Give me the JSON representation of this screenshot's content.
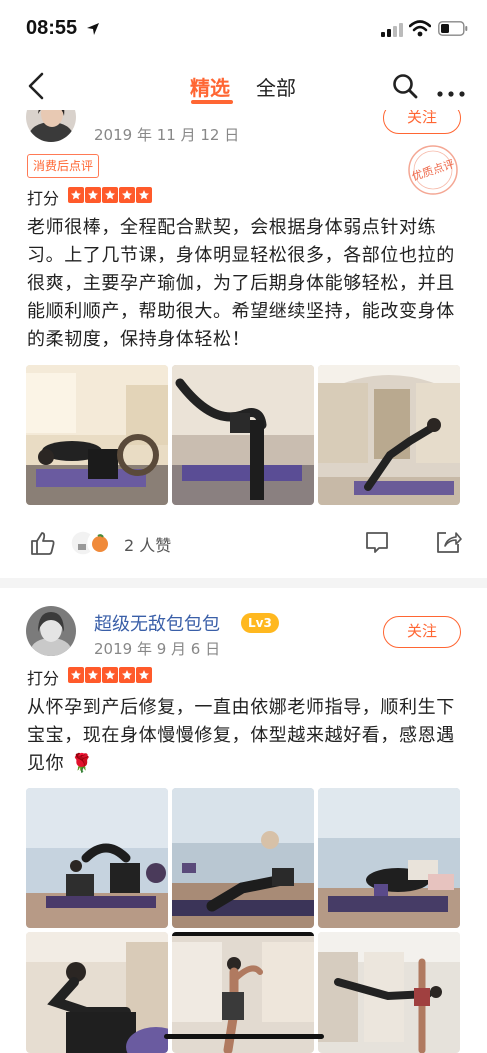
{
  "status_bar": {
    "time": "08:55"
  },
  "nav": {
    "tab_featured": "精选",
    "tab_all": "全部"
  },
  "reviews": [
    {
      "username": "",
      "date": "2019 年 11 月 12 日",
      "follow_label": "关注",
      "tag": "消费后点评",
      "score_label": "打分",
      "stars": 5,
      "text": "老师很棒，全程配合默契，会根据身体弱点针对练习。上了几节课，身体明显轻松很多，各部位也拉的很爽，主要孕产瑜伽，为了后期身体能够轻松，并且能顺利顺产，帮助很大。希望继续坚持，能改变身体的柔韧度，保持身体轻松！",
      "stamp_text": "优质点评",
      "likes": "2 人赞"
    },
    {
      "username": "超级无敌包包包",
      "level": "Lv3",
      "date": "2019 年 9 月 6 日",
      "follow_label": "关注",
      "score_label": "打分",
      "stars": 5,
      "text": "从怀孕到产后修复，一直由依娜老师指导，顺利生下宝宝，现在身体慢慢修复，体型越来越好看，感恩遇见你 🌹"
    }
  ]
}
